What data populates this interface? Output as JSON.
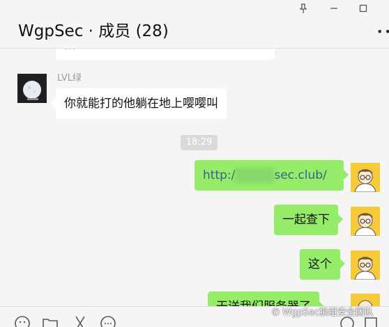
{
  "header": {
    "title": "WgpSec · 成员 (28)"
  },
  "messages": {
    "cut_left_text": "…",
    "sender_name": "LVL绿",
    "left_text": "你就能打的他躺在地上嘤嘤叫",
    "timestamp": "18:29",
    "url_prefix": "http:/",
    "url_suffix": "sec.club/",
    "msg2": "一起查下",
    "msg3": "这个",
    "msg4": "干送我们服务器了"
  },
  "watermark": "WgpSec狼组安全团队",
  "colors": {
    "background": "#f5f5f5",
    "own_bubble": "#95ec69",
    "other_bubble": "#ffffff",
    "timestamp_bg": "#dadada"
  }
}
